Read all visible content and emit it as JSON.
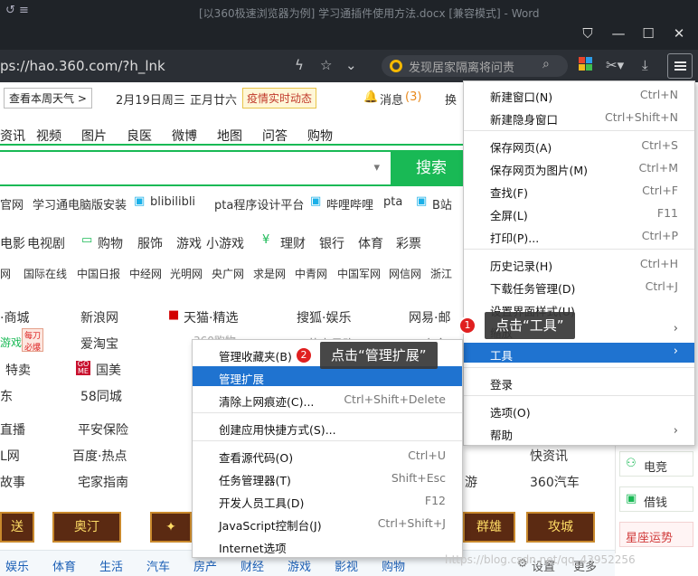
{
  "titlebar": {
    "title": "[以360极速浏览器为例] 学习通插件使用方法.docx [兼容模式] - Word",
    "left_icon": "↺ ≡"
  },
  "address": {
    "url": "ps://hao.360.com/?h_lnk",
    "search_placeholder": "发现居家隔离将问责"
  },
  "topinfo": {
    "weather_btn": "查看本周天气 >",
    "date": "2月19日周三",
    "lunar": "正月廿六",
    "epidemic": "疫情实时动态",
    "msg_label": "消息",
    "msg_count": "(3)",
    "change": "换"
  },
  "nav": [
    "资讯",
    "视频",
    "图片",
    "良医",
    "微博",
    "地图",
    "问答",
    "购物"
  ],
  "search_button": "搜索",
  "quicklinks": [
    "官网",
    "学习通电脑版安装",
    "blibilibli",
    "pta程序设计平台",
    "哔哩哔哩",
    "pta",
    "B站"
  ],
  "cats": [
    "电影",
    "电视剧",
    "购物",
    "服饰",
    "游戏",
    "小游戏",
    "理财",
    "银行",
    "体育",
    "彩票"
  ],
  "sites": [
    "网",
    "国际在线",
    "中国日报",
    "中经网",
    "光明网",
    "央广网",
    "求是网",
    "中青网",
    "中国军网",
    "网信网",
    "浙江"
  ],
  "grid": {
    "r1": [
      "·商城",
      "新浪网",
      "天猫·精选",
      "搜狐·娱乐",
      "网易·邮"
    ],
    "r2": [
      "游戏",
      "爱淘宝",
      "苏宁易购",
      "安全卫"
    ],
    "r3": [
      "特卖",
      "国美",
      "360购物"
    ],
    "r4": [
      "东",
      "58同城"
    ],
    "r5": [
      "直播",
      "平安保险"
    ],
    "r6": [
      "L网",
      "百度·热点",
      "快资讯"
    ],
    "r7": [
      "故事",
      "宅家指南",
      "游",
      "360汽车"
    ]
  },
  "banners": [
    "奥汀",
    "群雄",
    "攻城"
  ],
  "side_buttons": [
    "电竞",
    "借钱",
    "星座运势"
  ],
  "bottomnav": [
    "娱乐",
    "体育",
    "生活",
    "汽车",
    "房产",
    "财经",
    "游戏",
    "影视",
    "购物",
    "设置",
    "更多"
  ],
  "menu": {
    "new_window": "新建窗口(N)",
    "new_window_sc": "Ctrl+N",
    "incognito": "新建隐身窗口",
    "incognito_sc": "Ctrl+Shift+N",
    "save_page": "保存网页(A)",
    "save_page_sc": "Ctrl+S",
    "save_image": "保存网页为图片(M)",
    "save_image_sc": "Ctrl+M",
    "find": "查找(F)",
    "find_sc": "Ctrl+F",
    "fullscreen": "全屏(L)",
    "fullscreen_sc": "F11",
    "print": "打印(P)...",
    "print_sc": "Ctrl+P",
    "history": "历史记录(H)",
    "history_sc": "Ctrl+H",
    "downloads": "下载任务管理(D)",
    "downloads_sc": "Ctrl+J",
    "ui_style": "设置界面样式(U)",
    "zoom": "缩放",
    "tools": "工具",
    "login": "登录",
    "options": "选项(O)",
    "help": "帮助"
  },
  "submenu": {
    "bookmarks": "管理收藏夹(B)",
    "extensions": "管理扩展",
    "clear": "清除上网痕迹(C)...",
    "clear_sc": "Ctrl+Shift+Delete",
    "shortcut": "创建应用快捷方式(S)...",
    "source": "查看源代码(O)",
    "source_sc": "Ctrl+U",
    "taskmgr": "任务管理器(T)",
    "taskmgr_sc": "Shift+Esc",
    "devtools": "开发人员工具(D)",
    "devtools_sc": "F12",
    "jsconsole": "JavaScript控制台(J)",
    "jsconsole_sc": "Ctrl+Shift+J",
    "inet": "Internet选项"
  },
  "callouts": {
    "c1_num": "1",
    "c1_text": "点击“工具”",
    "c2_num": "2",
    "c2_text": "点击“管理扩展”"
  },
  "watermark": "https://blog.csdn.net/qq_43952256",
  "colors": {
    "accent": "#19b955",
    "highlight": "#1f73d0",
    "titlebar": "#1f2328"
  }
}
